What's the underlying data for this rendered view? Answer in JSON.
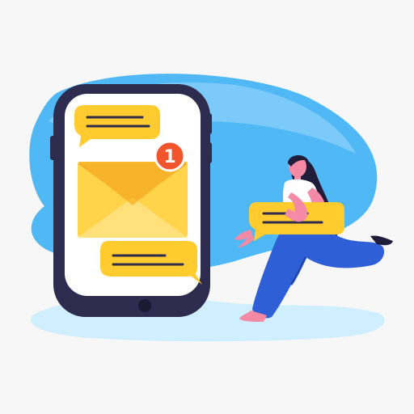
{
  "illustration": {
    "notification_badge": {
      "count": "1"
    }
  },
  "colors": {
    "background": "#f7f7f8",
    "blob_blue": "#4fb8f5",
    "blob_light": "#cfeefe",
    "phone_frame": "#2d2b4e",
    "phone_screen": "#ffffff",
    "bubble_yellow": "#ffcb2e",
    "envelope_yellow": "#ffd34a",
    "badge_red": "#f2552c",
    "pants_blue": "#2f5fd6",
    "shirt_white": "#ffffff",
    "hair_dark": "#1f1d3a",
    "skin_pink": "#f48aa6"
  },
  "icons": [
    "smartphone-icon",
    "envelope-icon",
    "chat-bubble-icon",
    "notification-badge-icon"
  ]
}
